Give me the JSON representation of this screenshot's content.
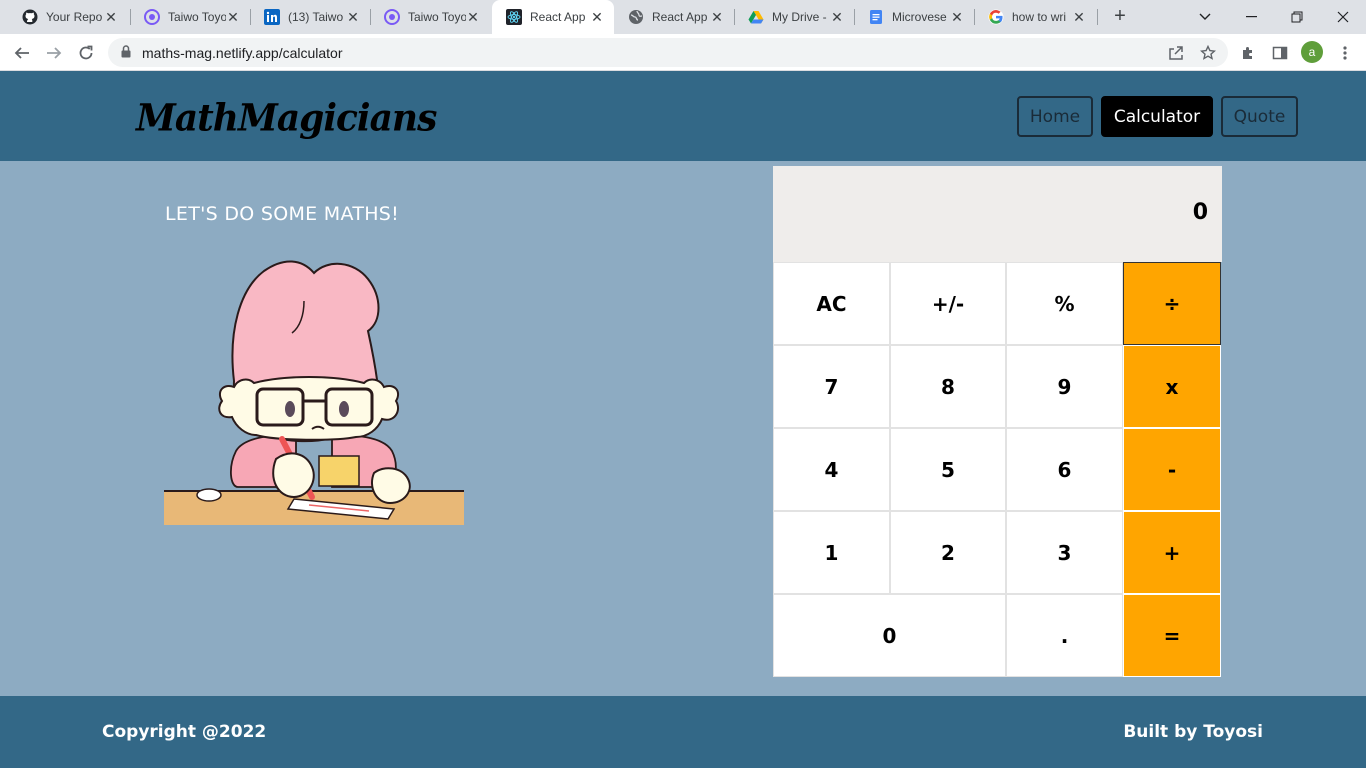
{
  "browser": {
    "tabs": [
      {
        "title": "Your Repo",
        "icon": "github-icon",
        "active": false
      },
      {
        "title": "Taiwo Toyo",
        "icon": "portfolio-icon",
        "active": false
      },
      {
        "title": "(13) Taiwo",
        "icon": "linkedin-icon",
        "active": false
      },
      {
        "title": "Taiwo Toyo",
        "icon": "portfolio-icon",
        "active": false
      },
      {
        "title": "React App",
        "icon": "react-icon",
        "active": true
      },
      {
        "title": "React App",
        "icon": "globe-icon",
        "active": false
      },
      {
        "title": "My Drive -",
        "icon": "google-drive-icon",
        "active": false
      },
      {
        "title": "Microvese",
        "icon": "google-docs-icon",
        "active": false
      },
      {
        "title": "how to wri",
        "icon": "google-icon",
        "active": false
      }
    ],
    "close_glyph": "✕",
    "new_tab_glyph": "+",
    "url": "maths-mag.netlify.app/calculator",
    "profile_initial": "a"
  },
  "header": {
    "logo": "MathMagicians",
    "nav": [
      {
        "label": "Home",
        "active": false
      },
      {
        "label": "Calculator",
        "active": true
      },
      {
        "label": "Quote",
        "active": false
      }
    ]
  },
  "main": {
    "greeting": "LET'S DO SOME MATHS!"
  },
  "calculator": {
    "display": "0",
    "keys": {
      "ac": "AC",
      "sign": "+/-",
      "percent": "%",
      "divide": "÷",
      "seven": "7",
      "eight": "8",
      "nine": "9",
      "multiply": "x",
      "four": "4",
      "five": "5",
      "six": "6",
      "minus": "-",
      "one": "1",
      "two": "2",
      "three": "3",
      "plus": "+",
      "zero": "0",
      "dot": ".",
      "equals": "="
    },
    "colors": {
      "operator": "#ffa500",
      "display_bg": "#efedeb"
    }
  },
  "footer": {
    "copyright": "Copyright @2022",
    "credit": "Built by Toyosi"
  },
  "colors": {
    "header": "#336887",
    "page_bg": "#8dabc2"
  }
}
